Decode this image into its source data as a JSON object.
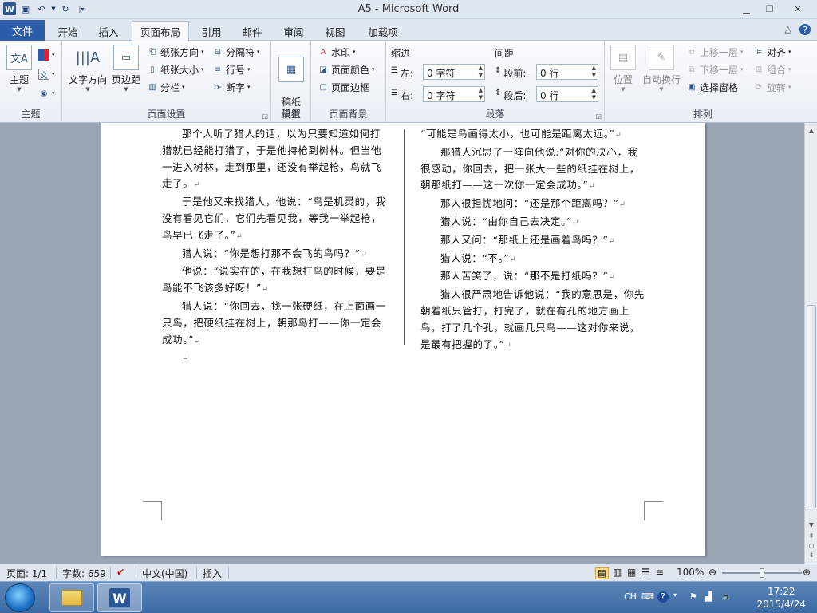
{
  "window": {
    "title": "A5 - Microsoft Word",
    "minimize_icon": "minimize-icon",
    "maximize_icon": "restore-icon",
    "close_icon": "close-icon"
  },
  "quick_access": {
    "items": [
      "word-logo-icon",
      "save-icon",
      "undo-icon",
      "redo-icon",
      "customize-icon"
    ]
  },
  "tabs": {
    "file": "文件",
    "items": [
      "开始",
      "插入",
      "页面布局",
      "引用",
      "邮件",
      "审阅",
      "视图",
      "加载项"
    ],
    "active": "页面布局"
  },
  "ribbon": {
    "theme": {
      "label": "主题",
      "theme_btn": "主题"
    },
    "page_setup": {
      "label": "页面设置",
      "text_direction": "文字方向",
      "margins": "页边距",
      "orientation": "纸张方向",
      "size": "纸张大小",
      "columns": "分栏",
      "breaks": "分隔符",
      "line_numbers": "行号",
      "hyphenation": "断字"
    },
    "paper": {
      "label": "稿纸",
      "btn": "稿纸\n设置"
    },
    "page_background": {
      "label": "页面背景",
      "watermark": "水印",
      "page_color": "页面颜色",
      "page_borders": "页面边框"
    },
    "paragraph": {
      "label": "段落",
      "indent": "缩进",
      "spacing": "间距",
      "left": "左:",
      "right": "右:",
      "before": "段前:",
      "after": "段后:",
      "left_value": "0 字符",
      "right_value": "0 字符",
      "before_value": "0 行",
      "after_value": "0 行"
    },
    "arrange": {
      "label": "排列",
      "position": "位置",
      "wrap": "自动换行",
      "bring_forward": "上移一层",
      "send_backward": "下移一层",
      "selection_pane": "选择窗格",
      "align": "对齐",
      "group": "组合",
      "rotate": "旋转"
    }
  },
  "document": {
    "left_column": [
      "那个人听了猎人的话，以为只要知道如何打猎就已经能打猎了，于是他持枪到树林。但当他一进入树林，走到那里，还没有举起枪，鸟就飞走了。",
      "于是他又来找猎人，他说：“鸟是机灵的，我没有看见它们，它们先看见我，等我一举起枪，鸟早已飞走了。”",
      "猎人说：“你是想打那不会飞的鸟吗？”",
      "他说：“说实在的，在我想打鸟的时候，要是鸟能不飞该多好呀！”",
      "猎人说：“你回去，找一张硬纸，在上面画一只鸟，把硬纸挂在树上，朝那鸟打——你一定会成功。”"
    ],
    "right_column": [
      "“可能是鸟画得太小，也可能是距离太远。”",
      "那猎人沉思了一阵向他说:“对你的决心，我很感动，你回去，把一张大一些的纸挂在树上，朝那纸打——这一次你一定会成功。”",
      "那人很担忧地问：“还是那个距离吗？”",
      "猎人说：“由你自己去决定。”",
      "那人又问：“那纸上还是画着鸟吗？”",
      "猎人说：“不。”",
      "那人苦笑了，说：“那不是打纸吗？”",
      "猎人很严肃地告诉他说：“我的意思是，你先朝着纸只管打，打完了，就在有孔的地方画上鸟，打了几个孔，就画几只鸟——这对你来说，是最有把握的了。”"
    ],
    "paragraph_mark": "↵"
  },
  "statusbar": {
    "page": "页面: 1/1",
    "words": "字数: 659",
    "language": "中文(中国)",
    "mode": "插入",
    "zoom": "100%",
    "zoom_level": 1.0
  },
  "taskbar": {
    "time": "17:22",
    "date": "2015/4/24",
    "ime": "CH"
  }
}
